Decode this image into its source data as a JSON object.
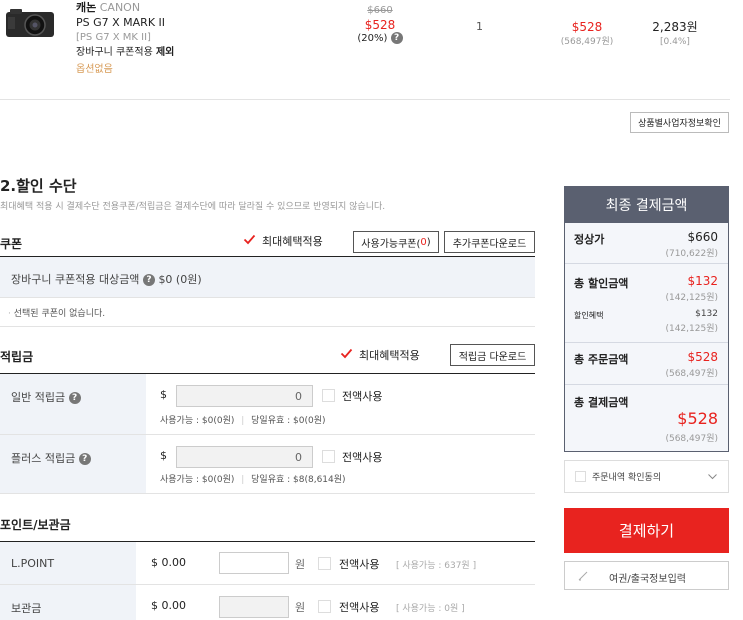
{
  "product": {
    "brand_ko": "캐논",
    "brand_en": "CANON",
    "name": "PS G7 X MARK II",
    "code": "[PS G7 X MK II]",
    "coupon_note_prefix": "장바구니 쿠폰적용",
    "coupon_note_bold": "제외",
    "option": "옵션없음",
    "original_price": "$660",
    "sale_price": "$528",
    "discount_rate": "(20%)",
    "quantity": "1",
    "total_price": "$528",
    "total_price_won": "(568,497원)",
    "points": "2,283원",
    "points_rate": "[0.4%]"
  },
  "business_info_button": "상품별사업자정보확인",
  "discount_section": {
    "title": "2.할인 수단",
    "note": "최대혜택 적용 시 결제수단 전용쿠폰/적립금은 결제수단에 따라 달라질 수 있으므로 반영되지 않습니다."
  },
  "coupon": {
    "label": "쿠폰",
    "max_benefit": "최대혜택적용",
    "available_btn_prefix": "사용가능쿠폰(",
    "available_count": "0",
    "available_btn_suffix": ")",
    "download_btn": "추가쿠폰다운로드",
    "cart_coupon_label": "장바구니 쿠폰적용 대상금액",
    "cart_coupon_value": "$0 (0원)",
    "none_selected": "선택된 쿠폰이 없습니다."
  },
  "reserve": {
    "label": "적립금",
    "max_benefit": "최대혜택적용",
    "download_btn": "적립금 다운로드",
    "general": {
      "label": "일반 적립금",
      "currency": "$",
      "value": "0",
      "all_use": "전액사용",
      "available": "사용가능 : $0(0원)",
      "expiring": "당일유효 : $0(0원)"
    },
    "plus": {
      "label": "플러스 적립금",
      "currency": "$",
      "value": "0",
      "all_use": "전액사용",
      "available": "사용가능 : $0(0원)",
      "expiring": "당일유효 : $8(8,614원)"
    }
  },
  "points_section": {
    "label": "포인트/보관금",
    "lpoint": {
      "label": "L.POINT",
      "amount": "$ 0.00",
      "unit": "원",
      "all_use": "전액사용",
      "available": "[ 사용가능 : 637원 ]"
    },
    "deposit": {
      "label": "보관금",
      "amount": "$ 0.00",
      "unit": "원",
      "all_use": "전액사용",
      "available": "[ 사용가능 : 0원 ]"
    }
  },
  "summary": {
    "title": "최종 결제금액",
    "regular_label": "정상가",
    "regular_value": "$660",
    "regular_won": "(710,622원)",
    "discount_label": "총 할인금액",
    "discount_value": "$132",
    "discount_won": "(142,125원)",
    "benefit_label": "할인혜택",
    "benefit_value": "$132",
    "benefit_won": "(142,125원)",
    "order_label": "총 주문금액",
    "order_value": "$528",
    "order_won": "(568,497원)",
    "pay_label": "총 결제금액",
    "pay_value": "$528",
    "pay_won": "(568,497원)"
  },
  "agree_label": "주문내역 확인동의",
  "pay_button": "결제하기",
  "passport_button": "여권/출국정보입력",
  "colors": {
    "accent_red": "#e8231f",
    "navy": "#5a6070",
    "row_bg": "#f0f3f8"
  }
}
